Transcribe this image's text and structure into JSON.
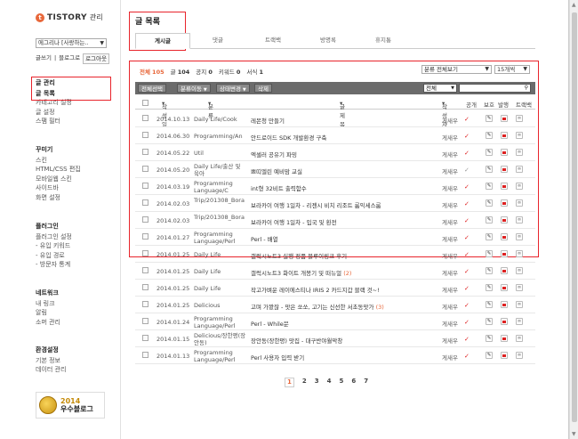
{
  "sidebar": {
    "brand": "TISTORY",
    "brand_suffix": "관리",
    "logo_mark": "t",
    "blog_select": "에그리나 [사랑하는..",
    "links": [
      "글쓰기",
      "블로그로",
      "로그아웃"
    ],
    "groups": [
      {
        "head": "글 관리",
        "items": [
          "글 목록",
          "카테고리 설정",
          "글 설정",
          "스팸 필터"
        ]
      },
      {
        "head": "꾸미기",
        "items": [
          "스킨",
          "HTML/CSS 편집",
          "모바일웹 스킨",
          "사이드바",
          "화면 설정"
        ]
      },
      {
        "head": "플러그인",
        "items": [
          "플러그인 설정",
          "- 유입 키워드",
          "- 유입 경로",
          "- 방문자 통계"
        ]
      },
      {
        "head": "네트워크",
        "items": [
          "내 링크",
          "알림",
          "소머 관리"
        ]
      },
      {
        "head": "환경설정",
        "items": [
          "기본 정보",
          "데이터 관리"
        ]
      }
    ],
    "award": {
      "year": "2014",
      "label": "우수블로그"
    }
  },
  "main": {
    "title": "글 목록",
    "tabs": [
      "게시글",
      "댓글",
      "트랙백",
      "방명록",
      "휴지통"
    ],
    "stats": {
      "total_label": "전체",
      "total": "105",
      "post_label": "글",
      "post": "104",
      "notice_label": "공지",
      "notice": "0",
      "keyword_label": "키워드",
      "keyword": "0",
      "form_label": "서식",
      "form": "1"
    },
    "filters": {
      "category": "분류 전체보기",
      "per_page": "15개씩"
    },
    "toolbar": {
      "select_all": "전체선택",
      "move_cat": "분류이동",
      "change_state": "상태변경",
      "delete": "삭제",
      "search_scope": "전체",
      "search_placeholder": ""
    },
    "columns": [
      "작성일",
      "분류",
      "글제목",
      "작성자",
      "공개",
      "보호",
      "발행",
      "트랙백"
    ],
    "rows": [
      {
        "date": "2014.10.13",
        "cat": "Daily Life/Cook",
        "title": "레몬청 만들기",
        "cmt": "",
        "author": "게새우",
        "pub": true
      },
      {
        "date": "2014.06.30",
        "cat": "Programming/An",
        "title": "안드로이드 SDK 개발환경 구축",
        "cmt": "",
        "author": "게새우",
        "pub": true
      },
      {
        "date": "2014.05.22",
        "cat": "Util",
        "title": "엑셀러 공유기 파밍",
        "cmt": "",
        "author": "게새우",
        "pub": true
      },
      {
        "date": "2014.05.20",
        "cat": "Daily Life/출산 및 육아",
        "title": "쁘띠엘린 예비맘 교실",
        "cmt": "",
        "author": "게새우",
        "pub": false
      },
      {
        "date": "2014.03.19",
        "cat": "Programming Language/C",
        "title": "int형 32비트 출력함수",
        "cmt": "",
        "author": "게새우",
        "pub": true
      },
      {
        "date": "2014.02.03",
        "cat": "Trip/201308_Bora",
        "title": "보라카이 여행 1일차 - 리젠시 비치 리조트 룸익세스룸",
        "cmt": "",
        "author": "게새우",
        "pub": true
      },
      {
        "date": "2014.02.03",
        "cat": "Trip/201308_Bora",
        "title": "보라카이 여행 1일차 - 입국 및 환전",
        "cmt": "",
        "author": "게새우",
        "pub": true
      },
      {
        "date": "2014.01.27",
        "cat": "Programming Language/Perl",
        "title": "Perl - 배열",
        "cmt": "",
        "author": "게새우",
        "pub": true
      },
      {
        "date": "2014.01.25",
        "cat": "Daily Life",
        "title": "갤럭시노트3 실행 정품 블루이링크 후기",
        "cmt": "",
        "author": "게새우",
        "pub": true
      },
      {
        "date": "2014.01.25",
        "cat": "Daily Life",
        "title": "갤럭시노트3 화이트 개봉기 및 떠뉴얼",
        "cmt": "(2)",
        "author": "게새우",
        "pub": true
      },
      {
        "date": "2014.01.25",
        "cat": "Daily Life",
        "title": "작고가벼운 레이에스티나 IRIS 2 카드지갑 블랙 것~!",
        "cmt": "",
        "author": "게새우",
        "pub": true
      },
      {
        "date": "2014.01.25",
        "cat": "Delicious",
        "title": "고며 가봤잖 - 맛은 쏘쏘, 고기는 신선한 서초동맛가",
        "cmt": "(3)",
        "author": "게새우",
        "pub": true
      },
      {
        "date": "2014.01.24",
        "cat": "Programming Language/Perl",
        "title": "Perl - While문",
        "cmt": "",
        "author": "게새우",
        "pub": true
      },
      {
        "date": "2014.01.15",
        "cat": "Delicious/장한평(장안동)",
        "title": "장안동(장한평) 맛집 - 대구반야월막창",
        "cmt": "",
        "author": "게새우",
        "pub": true
      },
      {
        "date": "2014.01.13",
        "cat": "Programming Language/Perl",
        "title": "Perl 사용자 입력 받기",
        "cmt": "",
        "author": "게새우",
        "pub": true
      }
    ],
    "pages": [
      "1",
      "2",
      "3",
      "4",
      "5",
      "6",
      "7"
    ]
  },
  "colors": {
    "accent": "#e8683b",
    "highlight": "#e8242b",
    "toolbar": "#6b6b6b"
  }
}
